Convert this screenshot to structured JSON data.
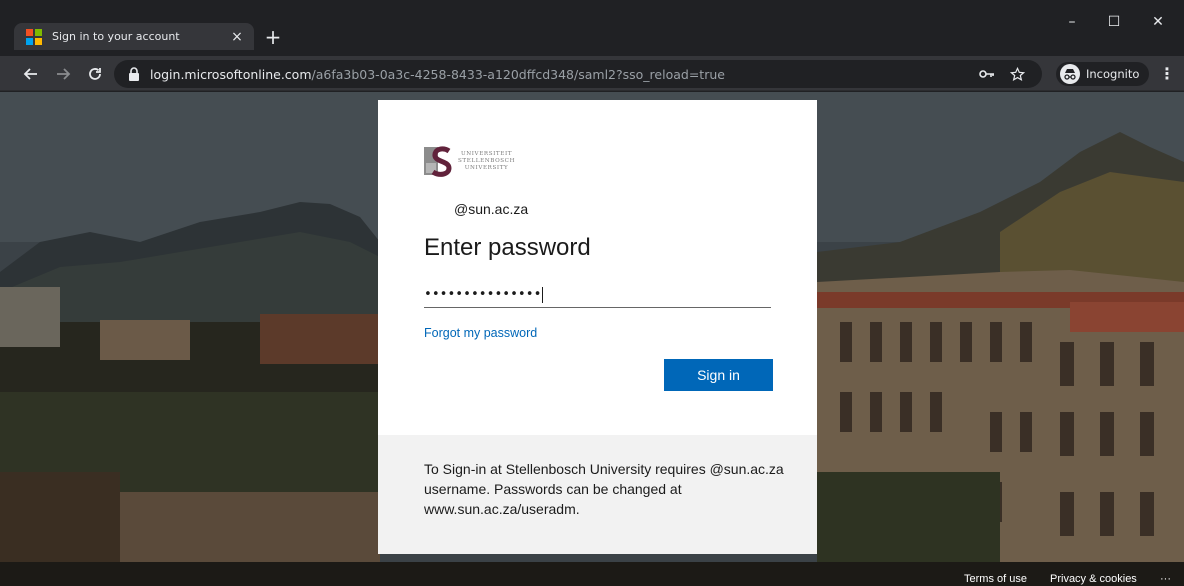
{
  "browser": {
    "tab": {
      "title": "Sign in to your account",
      "close_glyph": "×",
      "icon": "microsoft-logo"
    },
    "new_tab_glyph": "+",
    "window": {
      "minimize": "–",
      "maximize": "☐",
      "close": "✕"
    },
    "address": {
      "host": "login.microsoftonline.com",
      "path": "/a6fa3b03-0a3c-4258-8433-a120dffcd348/saml2?sso_reload=true"
    },
    "incognito_label": "Incognito",
    "menu_glyph": "⋮"
  },
  "card": {
    "org_name_lines": [
      "UNIVERSITEIT",
      "STELLENBOSCH",
      "UNIVERSITY"
    ],
    "identity": "@sun.ac.za",
    "heading": "Enter password",
    "password_mask": "•••••••••••••••",
    "forgot_link": "Forgot my password",
    "signin_button": "Sign in",
    "footer_text": "To Sign-in at Stellenbosch University requires @sun.ac.za username. Passwords can be changed at www.sun.ac.za/useradm."
  },
  "footer_links": {
    "terms": "Terms of use",
    "privacy": "Privacy & cookies",
    "more": "···"
  },
  "colors": {
    "accent": "#0067b8",
    "chrome_dark": "#202124",
    "chrome_toolbar": "#35363a",
    "sun_maroon": "#61223b"
  }
}
